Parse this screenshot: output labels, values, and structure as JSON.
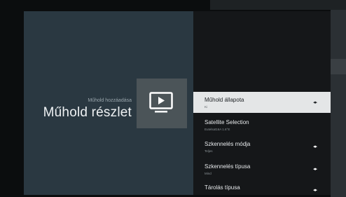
{
  "header": {
    "subtitle": "Műhold hozzáadása",
    "title": "Műhold részlet"
  },
  "menu": {
    "items": [
      {
        "label": "Műhold állapota",
        "value": "Ki",
        "has_arrows": true,
        "selected": true
      },
      {
        "label": "Satellite Selection",
        "value": "Eutelsat16A 1.6°E",
        "has_arrows": false,
        "selected": false
      },
      {
        "label": "Szkennelés módja",
        "value": "Teljes",
        "has_arrows": true,
        "selected": false
      },
      {
        "label": "Szkennelés típusa",
        "value": "Mind",
        "has_arrows": true,
        "selected": false
      },
      {
        "label": "Tárolás típusa",
        "value": "",
        "has_arrows": true,
        "selected": false
      }
    ],
    "arrow_glyph": "◂▸"
  },
  "icons": {
    "tile_icon": "tv-play-icon"
  },
  "colors": {
    "left_panel": "#2a3841",
    "right_panel": "#151719",
    "selected_item": "#e4e6e7",
    "icon_tile": "#4b5458"
  }
}
